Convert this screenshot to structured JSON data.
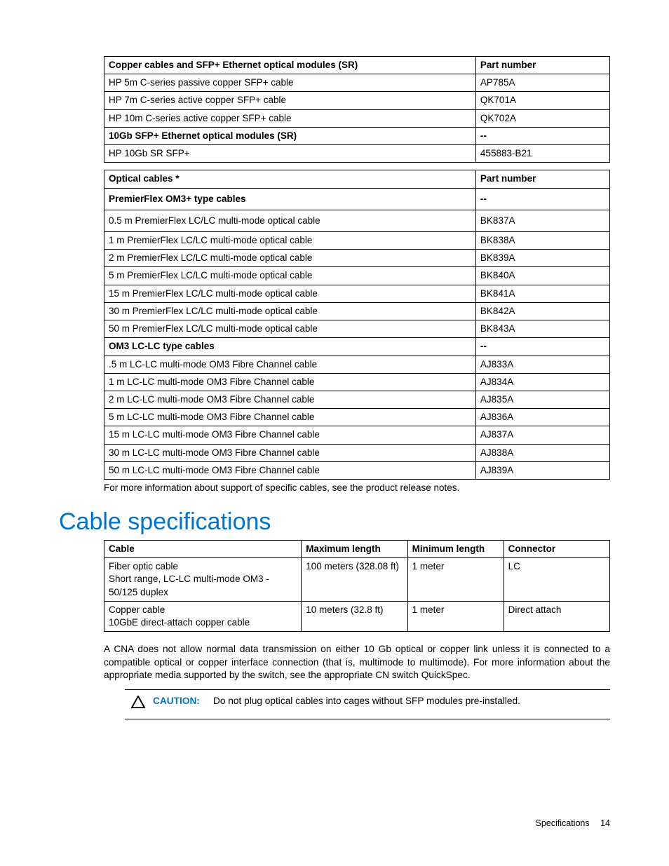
{
  "table1": {
    "headers": [
      "Copper cables and SFP+ Ethernet optical modules (SR)",
      "Part number"
    ],
    "rows": [
      {
        "c0": "HP 5m C-series passive copper SFP+ cable",
        "c1": "AP785A",
        "bold": false
      },
      {
        "c0": "HP 7m C-series active copper SFP+ cable",
        "c1": "QK701A",
        "bold": false
      },
      {
        "c0": "HP 10m C-series active copper SFP+ cable",
        "c1": "QK702A",
        "bold": false
      },
      {
        "c0": "10Gb SFP+ Ethernet optical modules (SR)",
        "c1": "--",
        "bold": true
      },
      {
        "c0": "HP 10Gb SR SFP+",
        "c1": "455883-B21",
        "bold": false
      }
    ]
  },
  "table2": {
    "headers": [
      "Optical cables *",
      "Part number"
    ],
    "rows": [
      {
        "c0": "PremierFlex OM3+ type cables",
        "c1": "--",
        "bold": true,
        "extra_pad": true
      },
      {
        "c0": "0.5 m PremierFlex LC/LC multi-mode optical cable",
        "c1": "BK837A",
        "bold": false,
        "extra_pad": true
      },
      {
        "c0": "1 m PremierFlex LC/LC multi-mode optical cable",
        "c1": "BK838A",
        "bold": false
      },
      {
        "c0": "2 m PremierFlex LC/LC multi-mode optical cable",
        "c1": "BK839A",
        "bold": false
      },
      {
        "c0": "5 m PremierFlex LC/LC multi-mode optical cable",
        "c1": "BK840A",
        "bold": false
      },
      {
        "c0": "15 m PremierFlex LC/LC multi-mode optical cable",
        "c1": "BK841A",
        "bold": false
      },
      {
        "c0": "30 m PremierFlex LC/LC multi-mode optical cable",
        "c1": "BK842A",
        "bold": false
      },
      {
        "c0": "50 m PremierFlex LC/LC multi-mode optical cable",
        "c1": "BK843A",
        "bold": false
      },
      {
        "c0": "OM3 LC-LC type cables",
        "c1": "--",
        "bold": true
      },
      {
        "c0": ".5 m LC-LC multi-mode OM3 Fibre Channel cable",
        "c1": "AJ833A",
        "bold": false
      },
      {
        "c0": "1 m LC-LC multi-mode OM3 Fibre Channel cable",
        "c1": "AJ834A",
        "bold": false
      },
      {
        "c0": "2 m LC-LC multi-mode OM3 Fibre Channel cable",
        "c1": "AJ835A",
        "bold": false
      },
      {
        "c0": "5 m LC-LC multi-mode OM3 Fibre Channel cable",
        "c1": "AJ836A",
        "bold": false
      },
      {
        "c0": "15 m LC-LC multi-mode OM3 Fibre Channel cable",
        "c1": "AJ837A",
        "bold": false
      },
      {
        "c0": "30 m LC-LC multi-mode OM3 Fibre Channel cable",
        "c1": "AJ838A",
        "bold": false
      },
      {
        "c0": "50 m LC-LC multi-mode OM3 Fibre Channel cable",
        "c1": "AJ839A",
        "bold": false
      }
    ]
  },
  "note_after_t2": "For more information about support of specific cables, see the product release notes.",
  "section_heading": "Cable specifications",
  "table3": {
    "headers": [
      "Cable",
      "Maximum length",
      "Minimum length",
      "Connector"
    ],
    "col_widths": [
      "39%",
      "21%",
      "19%",
      "21%"
    ],
    "rows": [
      {
        "c0": "Fiber optic cable\nShort range, LC-LC multi-mode OM3 - 50/125 duplex",
        "c1": "100 meters (328.08 ft)",
        "c2": "1 meter",
        "c3": "LC"
      },
      {
        "c0": "Copper cable\n10GbE direct-attach copper cable",
        "c1": "10 meters (32.8 ft)",
        "c2": "1 meter",
        "c3": "Direct attach"
      }
    ]
  },
  "body_para": "A CNA does not allow normal data transmission on either 10 Gb optical or copper link unless it is connected to a compatible optical or copper interface connection (that is, multimode to multimode). For more information about the appropriate media supported by the switch, see the appropriate CN switch QuickSpec.",
  "caution_label": "CAUTION:",
  "caution_text": "Do not plug optical cables into cages without SFP modules pre-installed.",
  "footer_label": "Specifications",
  "footer_page": "14"
}
